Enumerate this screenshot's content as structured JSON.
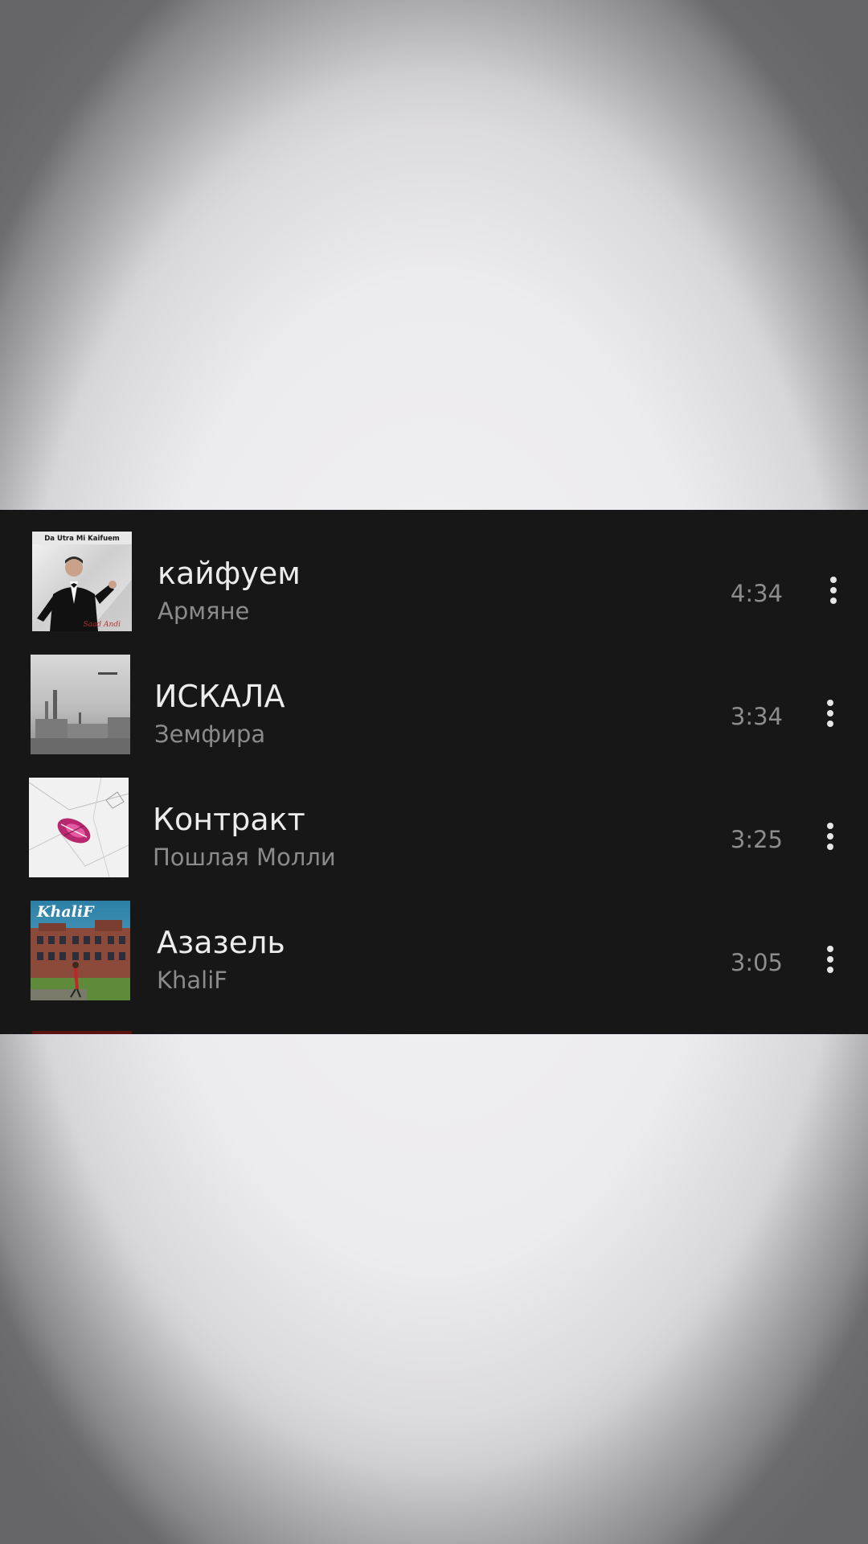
{
  "tracks": [
    {
      "title": "кайфуем",
      "artist": "Армяне",
      "duration": "4:34",
      "cover_text": "Da Utra Mi Kaifuem",
      "cover_signature": "Saad Andi"
    },
    {
      "title": "ИСКАЛА",
      "artist": "Земфира",
      "duration": "3:34",
      "cover_text": ""
    },
    {
      "title": "Контракт",
      "artist": "Пошлая Молли",
      "duration": "3:25",
      "cover_text": ""
    },
    {
      "title": "Азазель",
      "artist": "KhaliF",
      "duration": "3:05",
      "cover_text": "KhaliF"
    }
  ],
  "icons": {
    "menu": "more-vertical-icon"
  },
  "colors": {
    "panel_background": "#171718",
    "title_text": "#ececec",
    "secondary_text": "#8b8b8c",
    "page_background": "#ecebef"
  }
}
